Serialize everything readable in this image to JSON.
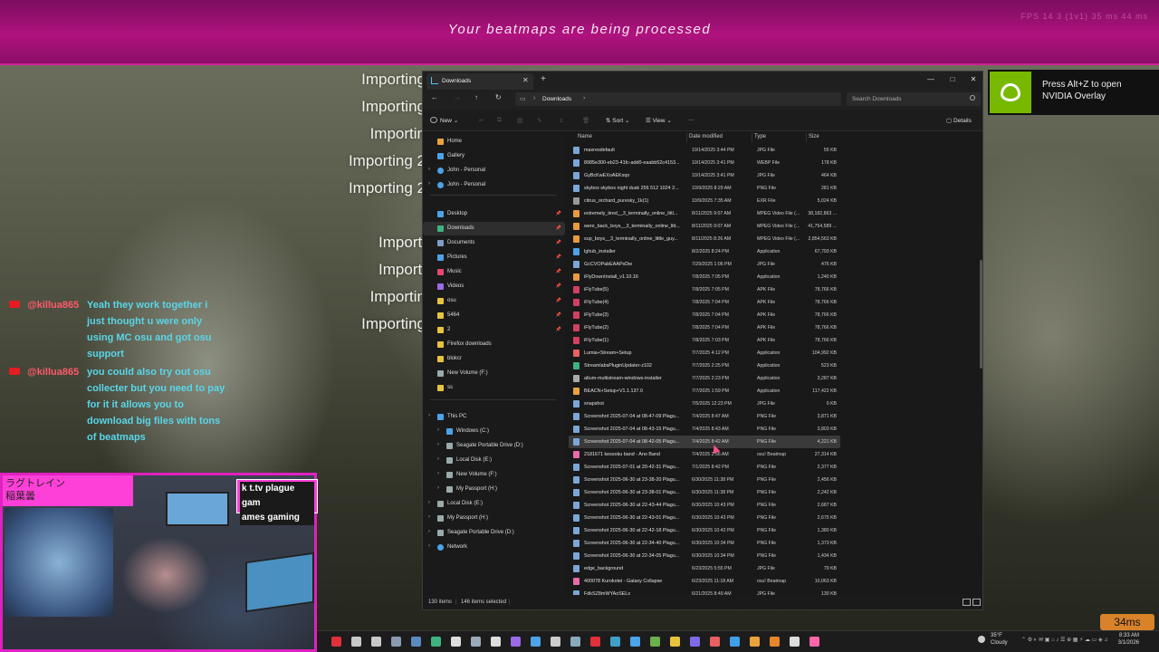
{
  "game": {
    "banner_title": "Your beatmaps are being processed",
    "stats_text": "FPS 14   3 (1v1)   35 ms   44 ms",
    "import_lines": [
      "Importing",
      "Importing",
      "Importin",
      "Importing 2",
      "Importing 2",
      "I",
      "Importi",
      "Importi",
      "Importin",
      "Importing"
    ],
    "ping": "34ms"
  },
  "chat": [
    {
      "user": "@killua865",
      "text": "Yeah they work together i just thought u were only using MC osu and got osu support"
    },
    {
      "user": "@killua865",
      "text": "you could also try out osu collecter but you need to pay for it it allows you to download big files with tons of beatmaps"
    }
  ],
  "webcam": {
    "overlay_jp": "ラグトレイン\n稲葉曇",
    "tag_line1": "k t.tv plague gam",
    "tag_line2": "ames gaming"
  },
  "nvidia": {
    "line1": "Press Alt+Z to open",
    "line2": "NVIDIA Overlay"
  },
  "explorer": {
    "tab_title": "Downloads",
    "breadcrumb": "Downloads",
    "search_placeholder": "Search Downloads",
    "toolbar": {
      "new": "New",
      "sort": "Sort",
      "view": "View",
      "more": "···",
      "details": "Details"
    },
    "columns": {
      "name": "Name",
      "date": "Date modified",
      "type": "Type",
      "size": "Size"
    },
    "status_items": "130 items",
    "status_selected": "146 items selected",
    "nav": [
      {
        "label": "Home",
        "kind": "home",
        "color": "#e8a33d"
      },
      {
        "label": "Gallery",
        "kind": "gallery",
        "color": "#4da3e8"
      },
      {
        "label": "John - Personal",
        "kind": "cloud",
        "color": "#4da3e8",
        "chev": true
      },
      {
        "label": "John - Personal",
        "kind": "cloud",
        "color": "#4da3e8",
        "chev": true
      },
      {
        "label": "Desktop",
        "kind": "folder",
        "color": "#4da3e8",
        "pin": true
      },
      {
        "label": "Downloads",
        "kind": "folder",
        "color": "#3fb37f",
        "pin": true,
        "selected": true
      },
      {
        "label": "Documents",
        "kind": "folder",
        "color": "#7c9ec8",
        "pin": true
      },
      {
        "label": "Pictures",
        "kind": "folder",
        "color": "#4da3e8",
        "pin": true
      },
      {
        "label": "Music",
        "kind": "folder",
        "color": "#e8476a",
        "pin": true
      },
      {
        "label": "Videos",
        "kind": "folder",
        "color": "#9d6ae8",
        "pin": true
      },
      {
        "label": "osu",
        "kind": "folder",
        "color": "#e8c43d",
        "pin": true
      },
      {
        "label": "5464",
        "kind": "folder",
        "color": "#e8c43d",
        "pin": true
      },
      {
        "label": "2",
        "kind": "folder",
        "color": "#e8c43d",
        "pin": true
      },
      {
        "label": "Firefox downloads",
        "kind": "folder",
        "color": "#e8c43d"
      },
      {
        "label": "blokcr",
        "kind": "folder",
        "color": "#e8c43d"
      },
      {
        "label": "New Volume (F:)",
        "kind": "drive",
        "color": "#9aa"
      },
      {
        "label": "ss",
        "kind": "folder",
        "color": "#e8c43d"
      },
      {
        "label": "This PC",
        "kind": "pc",
        "color": "#4da3e8",
        "chev": true
      },
      {
        "label": "Windows (C:)",
        "kind": "drive",
        "color": "#4da3e8",
        "chev": true,
        "indent": true
      },
      {
        "label": "Seagate Portable Drive (D:)",
        "kind": "drive",
        "color": "#9aa",
        "chev": true,
        "indent": true
      },
      {
        "label": "Local Disk (E:)",
        "kind": "drive",
        "color": "#9aa",
        "chev": true,
        "indent": true
      },
      {
        "label": "New Volume (F:)",
        "kind": "drive",
        "color": "#9aa",
        "chev": true,
        "indent": true
      },
      {
        "label": "My Passport (H:)",
        "kind": "drive",
        "color": "#9aa",
        "chev": true,
        "indent": true
      },
      {
        "label": "Local Disk (E:)",
        "kind": "drive",
        "color": "#9aa",
        "chev": true
      },
      {
        "label": "My Passport (H:)",
        "kind": "drive",
        "color": "#9aa",
        "chev": true
      },
      {
        "label": "Seagate Portable Drive (D:)",
        "kind": "drive",
        "color": "#9aa",
        "chev": true
      },
      {
        "label": "Network",
        "kind": "network",
        "color": "#4da3e8",
        "chev": true
      }
    ],
    "files": [
      {
        "name": "maxresdefault",
        "date": "10/14/2025 3:44 PM",
        "type": "JPG File",
        "size": "55 KB",
        "icon": "#7aa7d8"
      },
      {
        "name": "8985e300-eb23-41fc-add0-eaabb52c4153...",
        "date": "10/14/2025 3:41 PM",
        "type": "WEBP File",
        "size": "178 KB",
        "icon": "#7aa7d8"
      },
      {
        "name": "GyBcKwEXoAEKsqo",
        "date": "10/14/2025 3:41 PM",
        "type": "JPG File",
        "size": "464 KB",
        "icon": "#7aa7d8"
      },
      {
        "name": "skybox skybox night dusk 256 512 1024 2...",
        "date": "10/9/2025 8:29 AM",
        "type": "PNG File",
        "size": "281 KB",
        "icon": "#7aa7d8"
      },
      {
        "name": "citrus_orchard_puresky_1k(1)",
        "date": "10/9/2025 7:35 AM",
        "type": "EXR File",
        "size": "5,024 KB",
        "icon": "#999"
      },
      {
        "name": "extremely_tired__3_terminally_online_littl...",
        "date": "8/11/2025 9:07 AM",
        "type": "MPEG Video File (...",
        "size": "38,182,863 ...",
        "icon": "#e89a3d"
      },
      {
        "name": "were_back_boys__3_terminally_online_litt...",
        "date": "8/11/2025 9:07 AM",
        "type": "MPEG Video File (...",
        "size": "41,754,589 ...",
        "icon": "#e89a3d"
      },
      {
        "name": "sup_boys__3_terminally_online_little_guy...",
        "date": "8/11/2025 8:26 AM",
        "type": "MPEG Video File (...",
        "size": "2,854,563 KB",
        "icon": "#e89a3d"
      },
      {
        "name": "lghub_installer",
        "date": "8/2/2025 8:24 PM",
        "type": "Application",
        "size": "67,793 KB",
        "icon": "#4da3e8"
      },
      {
        "name": "GcCVOPabEAAPsDw",
        "date": "7/29/2025 1:06 PM",
        "type": "JPG File",
        "size": "476 KB",
        "icon": "#7aa7d8"
      },
      {
        "name": "iFlyDownInstall_v1.10.16",
        "date": "7/8/2025 7:05 PM",
        "type": "Application",
        "size": "1,240 KB",
        "icon": "#e89a3d"
      },
      {
        "name": "iFlyTube(5)",
        "date": "7/8/2025 7:05 PM",
        "type": "APK File",
        "size": "78,766 KB",
        "icon": "#d04060"
      },
      {
        "name": "iFlyTube(4)",
        "date": "7/8/2025 7:04 PM",
        "type": "APK File",
        "size": "78,766 KB",
        "icon": "#d04060"
      },
      {
        "name": "iFlyTube(3)",
        "date": "7/8/2025 7:04 PM",
        "type": "APK File",
        "size": "78,766 KB",
        "icon": "#d04060"
      },
      {
        "name": "iFlyTube(2)",
        "date": "7/8/2025 7:04 PM",
        "type": "APK File",
        "size": "78,766 KB",
        "icon": "#d04060"
      },
      {
        "name": "iFlyTube(1)",
        "date": "7/8/2025 7:03 PM",
        "type": "APK File",
        "size": "78,766 KB",
        "icon": "#d04060"
      },
      {
        "name": "Lumia+Stream+Setup",
        "date": "7/7/2025 4:12 PM",
        "type": "Application",
        "size": "104,992 KB",
        "icon": "#e86060"
      },
      {
        "name": "StreamlabsPluginUpdater-z102",
        "date": "7/7/2025 2:25 PM",
        "type": "Application",
        "size": "523 KB",
        "icon": "#3fb37f"
      },
      {
        "name": "altum-multistream-windows-installer",
        "date": "7/7/2025 2:23 PM",
        "type": "Application",
        "size": "3,287 KB",
        "icon": "#aaa"
      },
      {
        "name": "BEACN+Setup+V1.1.137.0",
        "date": "7/7/2025 1:59 PM",
        "type": "Application",
        "size": "117,422 KB",
        "icon": "#e8a33d"
      },
      {
        "name": "snapshot",
        "date": "7/5/2025 12:23 PM",
        "type": "JPG File",
        "size": "0 KB",
        "icon": "#7aa7d8"
      },
      {
        "name": "Screenshot 2025-07-04 at 08-47-09 Plagu...",
        "date": "7/4/2025 8:47 AM",
        "type": "PNG File",
        "size": "3,871 KB",
        "icon": "#7aa7d8"
      },
      {
        "name": "Screenshot 2025-07-04 at 08-43-15 Plagu...",
        "date": "7/4/2025 8:43 AM",
        "type": "PNG File",
        "size": "3,803 KB",
        "icon": "#7aa7d8"
      },
      {
        "name": "Screenshot 2025-07-04 at 08-42-05 Plagu...",
        "date": "7/4/2025 8:42 AM",
        "type": "PNG File",
        "size": "4,221 KB",
        "icon": "#7aa7d8",
        "selected": true
      },
      {
        "name": "2181671 kessoku band - Ano Band",
        "date": "7/4/2025 2:56 AM",
        "type": "osu! Beatmap",
        "size": "27,314 KB",
        "icon": "#e86aa8"
      },
      {
        "name": "Screenshot 2025-07-01 at 20-42-31 Plagu...",
        "date": "7/1/2025 8:42 PM",
        "type": "PNG File",
        "size": "2,377 KB",
        "icon": "#7aa7d8"
      },
      {
        "name": "Screenshot 2025-06-30 at 23-38-20 Plagu...",
        "date": "6/30/2025 11:38 PM",
        "type": "PNG File",
        "size": "2,456 KB",
        "icon": "#7aa7d8"
      },
      {
        "name": "Screenshot 2025-06-30 at 23-38-01 Plagu...",
        "date": "6/30/2025 11:38 PM",
        "type": "PNG File",
        "size": "2,242 KB",
        "icon": "#7aa7d8"
      },
      {
        "name": "Screenshot 2025-06-30 at 22-43-44 Plagu...",
        "date": "6/30/2025 10:43 PM",
        "type": "PNG File",
        "size": "2,687 KB",
        "icon": "#7aa7d8"
      },
      {
        "name": "Screenshot 2025-06-30 at 22-43-01 Plagu...",
        "date": "6/30/2025 10:43 PM",
        "type": "PNG File",
        "size": "2,675 KB",
        "icon": "#7aa7d8"
      },
      {
        "name": "Screenshot 2025-06-30 at 22-42-18 Plagu...",
        "date": "6/30/2025 10:42 PM",
        "type": "PNG File",
        "size": "1,380 KB",
        "icon": "#7aa7d8"
      },
      {
        "name": "Screenshot 2025-06-30 at 22-34-40 Plagu...",
        "date": "6/30/2025 10:34 PM",
        "type": "PNG File",
        "size": "1,373 KB",
        "icon": "#7aa7d8"
      },
      {
        "name": "Screenshot 2025-06-30 at 22-34-05 Plagu...",
        "date": "6/30/2025 10:34 PM",
        "type": "PNG File",
        "size": "1,434 KB",
        "icon": "#7aa7d8"
      },
      {
        "name": "edge_background",
        "date": "6/23/2025 5:55 PM",
        "type": "JPG File",
        "size": "79 KB",
        "icon": "#7aa7d8"
      },
      {
        "name": "400078 Kurokotei - Galaxy Collapse",
        "date": "6/23/2025 11:18 AM",
        "type": "osu! Beatmap",
        "size": "10,063 KB",
        "icon": "#e86aa8"
      },
      {
        "name": "FdkSZ8mWYAoSELx",
        "date": "6/21/2025 8:49 AM",
        "type": "JPG File",
        "size": "130 KB",
        "icon": "#7aa7d8"
      }
    ]
  },
  "taskbar": {
    "weather_temp": "35°F",
    "weather_desc": "Cloudy",
    "time": "8:33 AM",
    "date": "3/1/2026",
    "icons": [
      {
        "name": "streamlabs-icon",
        "color": "#e0303a"
      },
      {
        "name": "steam-icon",
        "color": "#c8c8c8"
      },
      {
        "name": "discord-icon",
        "color": "#c8c8c8"
      },
      {
        "name": "camera-icon",
        "color": "#8a9ab0"
      },
      {
        "name": "photos-icon",
        "color": "#5a8ac0"
      },
      {
        "name": "xbox-icon",
        "color": "#3fb37f"
      },
      {
        "name": "obs-icon",
        "color": "#ddd"
      },
      {
        "name": "settings-icon",
        "color": "#9ab"
      },
      {
        "name": "github-icon",
        "color": "#ddd"
      },
      {
        "name": "vs-icon",
        "color": "#9b6ae8"
      },
      {
        "name": "chrome-icon",
        "color": "#4da3e8"
      },
      {
        "name": "terminal-icon",
        "color": "#ccc"
      },
      {
        "name": "notepad-icon",
        "color": "#8ab"
      },
      {
        "name": "youtube-icon",
        "color": "#e0303a"
      },
      {
        "name": "edge-icon",
        "color": "#3fa0c8"
      },
      {
        "name": "store-icon",
        "color": "#4da3e8"
      },
      {
        "name": "minecraft-icon",
        "color": "#6ab04c"
      },
      {
        "name": "chrome2-icon",
        "color": "#e8c43d"
      },
      {
        "name": "calendar-icon",
        "color": "#7c6ae8"
      },
      {
        "name": "app-icon",
        "color": "#e86060"
      },
      {
        "name": "photoshop-icon",
        "color": "#3fa0e8"
      },
      {
        "name": "paint-icon",
        "color": "#e8a33d"
      },
      {
        "name": "vlc-icon",
        "color": "#e8872a"
      },
      {
        "name": "notion-icon",
        "color": "#ddd"
      },
      {
        "name": "osu-icon",
        "color": "#ff66aa"
      }
    ]
  }
}
